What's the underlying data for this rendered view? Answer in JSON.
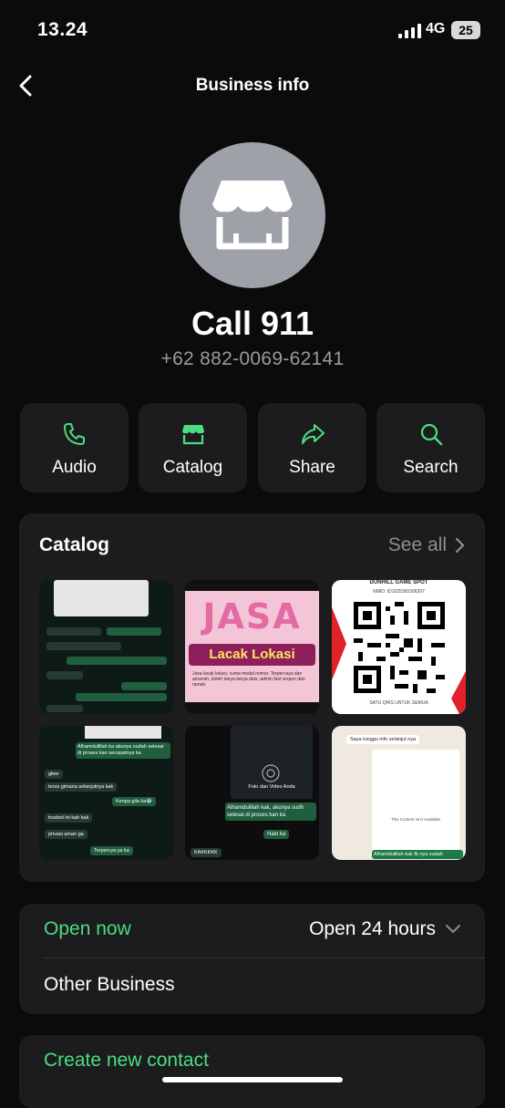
{
  "status_bar": {
    "time": "13.24",
    "network": "4G",
    "battery": "25"
  },
  "header": {
    "title": "Business info"
  },
  "profile": {
    "name": "Call 911",
    "phone": "+62 882-0069-62141"
  },
  "actions": [
    {
      "label": "Audio",
      "icon": "phone-icon"
    },
    {
      "label": "Catalog",
      "icon": "storefront-icon"
    },
    {
      "label": "Share",
      "icon": "share-icon"
    },
    {
      "label": "Search",
      "icon": "search-icon"
    }
  ],
  "catalog": {
    "title": "Catalog",
    "see_all": "See all",
    "items": [
      {
        "caption": "Chat screenshot"
      },
      {
        "title": "JASA",
        "subtitle": "Lacak Lokasi",
        "body": "Jasa lacak lokasi, cuma modal nomor. Terpercaya dan amanah, boleh tanya-tanya dulu, admin fast respon dan ramah."
      },
      {
        "header": "DUNHILL GAME SPOT",
        "nmid": "NMID: ID1025365306307",
        "footer": "SATU QRIS UNTUK SEMUA"
      },
      {
        "lines": [
          "Alhamdulillah ka akunya sudah selesai di proses kan secepatnya ka",
          "gilee",
          "terus gimana selanjutnya kak",
          "Kenpa gila ka😂",
          "trusted ini kah kak",
          "privasi aman ga",
          "Terpercya ya ka"
        ]
      },
      {
        "lines": [
          "Foto dan Video Anda",
          "Alhamdulillah kak, akunya sudh selesai di proses kan ka",
          "Halo ka",
          "KAKKKKK"
        ]
      },
      {
        "lines": [
          "Saya tunggu info selanjut nya",
          "This Content Isn't Available",
          "Alhamdulillah kak fb nya sudah"
        ]
      }
    ]
  },
  "info": {
    "open_now": "Open now",
    "hours": "Open 24 hours",
    "category": "Other Business"
  },
  "create_contact": "Create new contact",
  "colors": {
    "accent": "#4ade80",
    "card": "#1c1c1e",
    "background": "#0b0b0c"
  }
}
